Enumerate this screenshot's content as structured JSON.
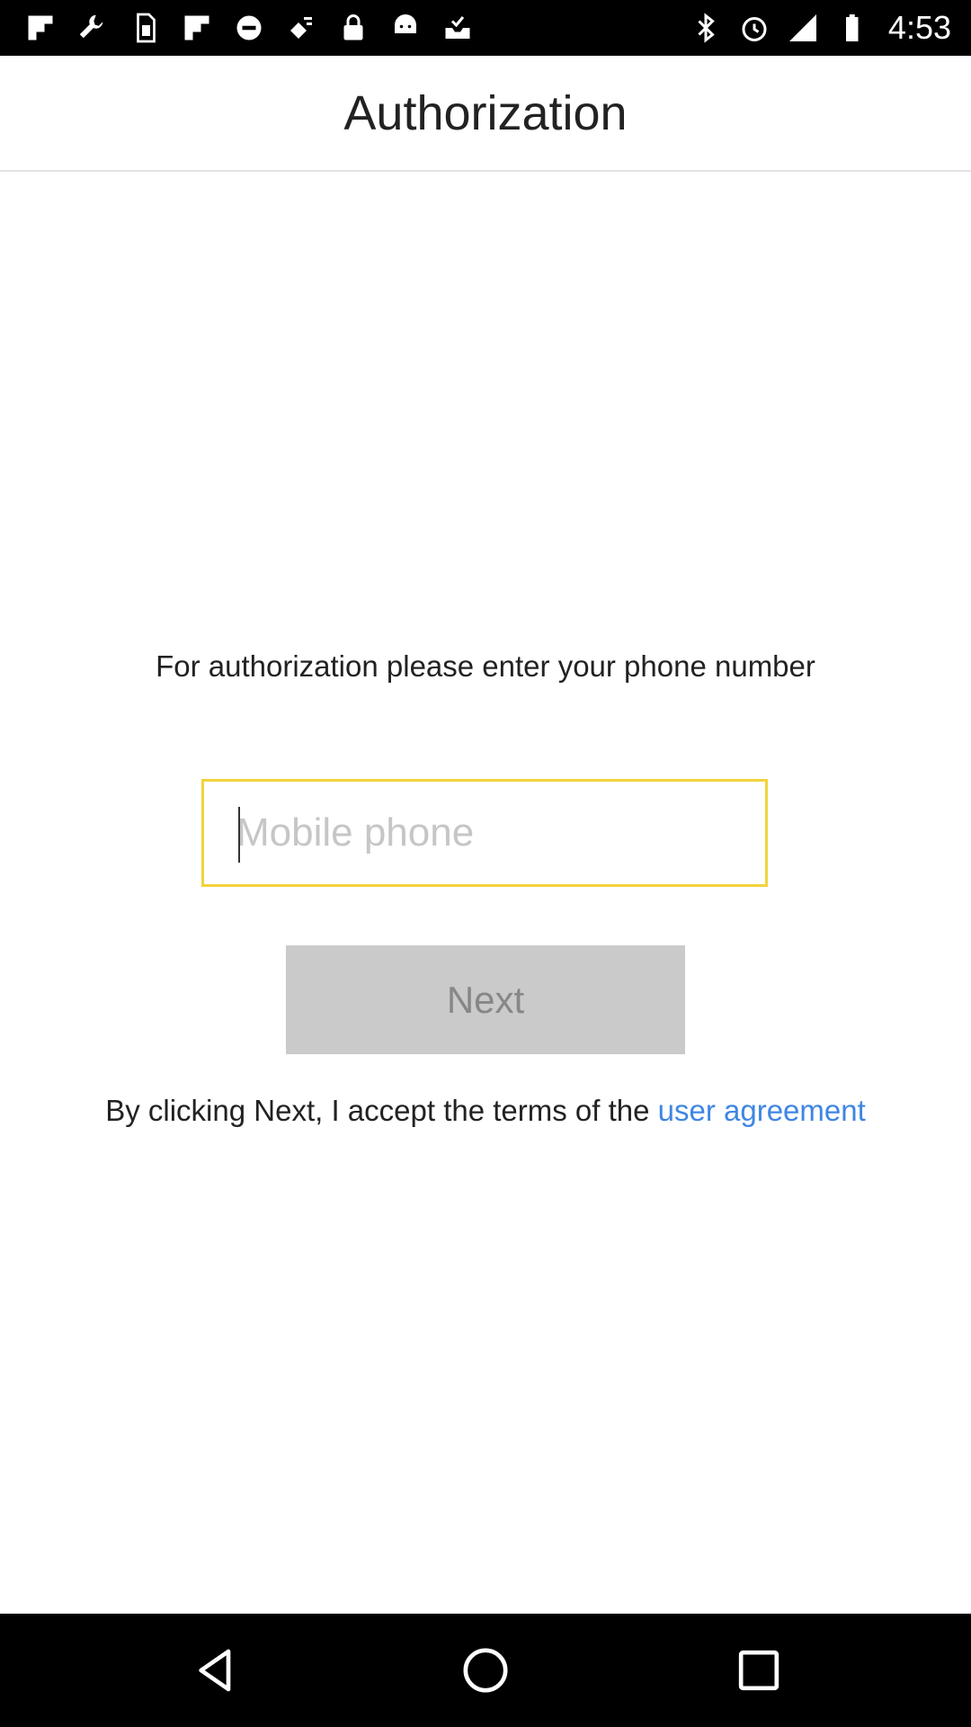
{
  "status_bar": {
    "time": "4:53",
    "left_icons": [
      "flipboard-icon",
      "wrench-icon",
      "sim-card-icon",
      "flipboard-icon",
      "do-not-disturb-icon",
      "fake-gps-icon",
      "lock-icon",
      "android-icon",
      "inbox-check-icon"
    ],
    "right_icons": [
      "bluetooth-icon",
      "alarm-icon",
      "signal-icon",
      "battery-icon"
    ]
  },
  "app_bar": {
    "title": "Authorization"
  },
  "form": {
    "instruction": "For authorization please enter your phone number",
    "phone_value": "",
    "phone_placeholder": "Mobile phone",
    "next_label": "Next",
    "terms_text": "By clicking Next, I accept the terms of the ",
    "terms_link": "user agreement"
  },
  "colors": {
    "input_border": "#f2d33c",
    "button_bg": "#cacaca",
    "button_text": "#878787",
    "link": "#3f86e3"
  },
  "nav_bar": {
    "buttons": [
      "back-icon",
      "home-icon",
      "recent-apps-icon"
    ]
  }
}
